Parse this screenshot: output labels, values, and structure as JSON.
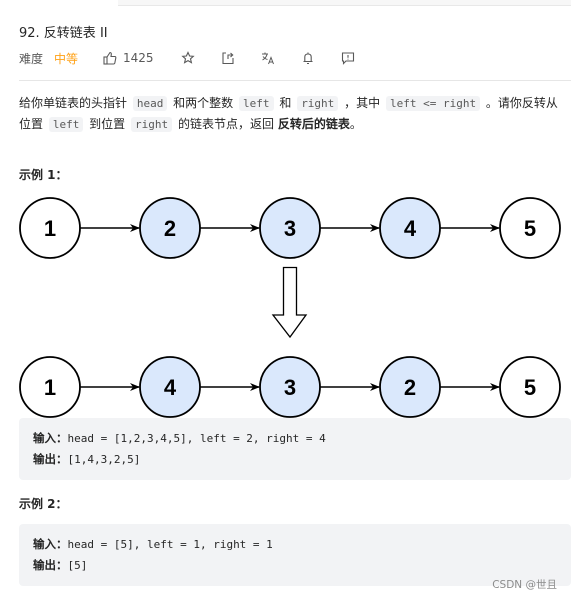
{
  "problem": {
    "title": "92. 反转链表 II",
    "difficulty_label": "难度",
    "difficulty_value": "中等",
    "like_count": "1425",
    "toolbar_icons": [
      "thumbs-up-icon",
      "star-icon",
      "share-icon",
      "translate-icon",
      "bell-icon",
      "feedback-icon"
    ]
  },
  "description": {
    "p1": "给你单链表的头指针",
    "c_head": "head",
    "p2": "和两个整数",
    "c_left": "left",
    "p3": "和",
    "c_right": "right",
    "p4": "，其中",
    "c_cond": "left <= right",
    "p5": "。请你反转从位置",
    "c_left2": "left",
    "p6": "到位置",
    "c_right2": "right",
    "p7": "的链表节点，返回",
    "bold": "反转后的链表",
    "p8": "。"
  },
  "examples": [
    {
      "title": "示例 1：",
      "diagram": {
        "before": [
          1,
          2,
          3,
          4,
          5
        ],
        "after": [
          1,
          4,
          3,
          2,
          5
        ],
        "highlighted_positions": [
          2,
          3,
          4
        ],
        "highlight_color": "#dae8fc",
        "plain_color": "#ffffff"
      },
      "input_label": "输入：",
      "input": "head = [1,2,3,4,5], left = 2, right = 4",
      "output_label": "输出：",
      "output": "[1,4,3,2,5]"
    },
    {
      "title": "示例 2：",
      "input_label": "输入：",
      "input": "head = [5], left = 1, right = 1",
      "output_label": "输出：",
      "output": "[5]"
    }
  ],
  "watermark": "CSDN @世且",
  "colors": {
    "accent_orange": "#ffa116",
    "code_bg": "#f2f3f5"
  }
}
